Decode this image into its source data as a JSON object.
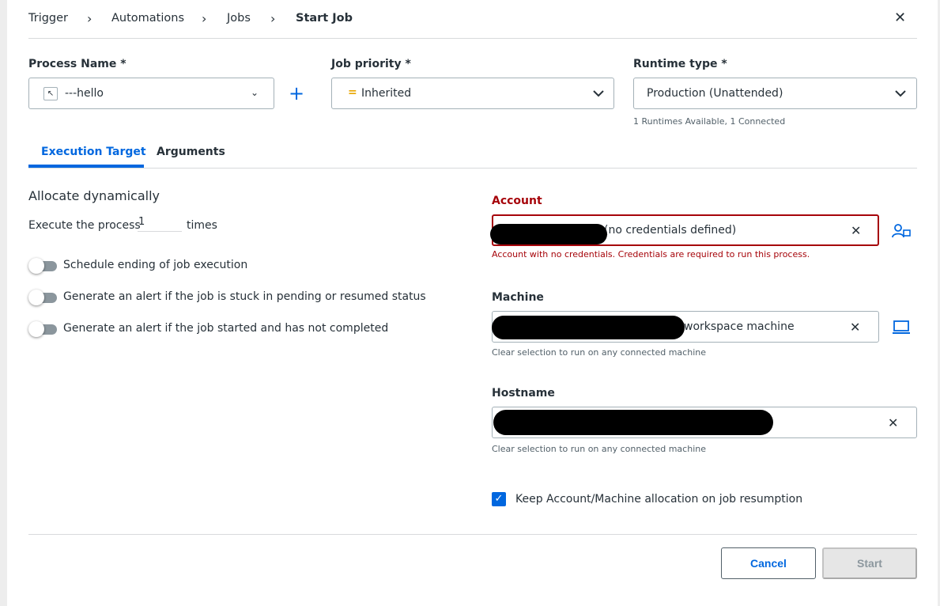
{
  "breadcrumb": {
    "items": [
      "Trigger",
      "Automations",
      "Jobs",
      "Start Job"
    ],
    "separator": "›"
  },
  "close_icon": "close-icon",
  "process": {
    "label": "Process Name *",
    "value": "---hello",
    "icon": "process-cursor-icon"
  },
  "add_icon": "plus-icon",
  "priority": {
    "label": "Job priority *",
    "value": "Inherited",
    "icon_glyph": "=",
    "icon_color": "#e8a600"
  },
  "runtime": {
    "label": "Runtime type *",
    "value": "Production (Unattended)",
    "hint": "1 Runtimes Available, 1 Connected"
  },
  "tabs": [
    {
      "label": "Execution Target",
      "active": true
    },
    {
      "label": "Arguments",
      "active": false
    }
  ],
  "allocate": {
    "title": "Allocate dynamically",
    "execute_prefix": "Execute the process",
    "execute_value": "1",
    "execute_suffix": "times"
  },
  "toggles": [
    {
      "label": "Schedule ending of job execution",
      "on": false
    },
    {
      "label": "Generate an alert if the job is stuck in pending or resumed status",
      "on": false
    },
    {
      "label": "Generate an alert if the job started and has not completed",
      "on": false
    }
  ],
  "account": {
    "label": "Account",
    "value_suffix": "(no credentials defined)",
    "error": "Account with no credentials. Credentials are required to run this process.",
    "icon": "user-group-icon",
    "error_color": "#a6040a"
  },
  "machine": {
    "label": "Machine",
    "value_suffix": "workspace machine",
    "hint": "Clear selection to run on any connected machine",
    "icon": "laptop-icon"
  },
  "hostname": {
    "label": "Hostname",
    "hint": "Clear selection to run on any connected machine"
  },
  "keep_allocation": {
    "label": "Keep Account/Machine allocation on job resumption",
    "checked": true
  },
  "buttons": {
    "cancel": "Cancel",
    "start": "Start"
  },
  "colors": {
    "accent": "#0067df",
    "error": "#a6040a"
  }
}
